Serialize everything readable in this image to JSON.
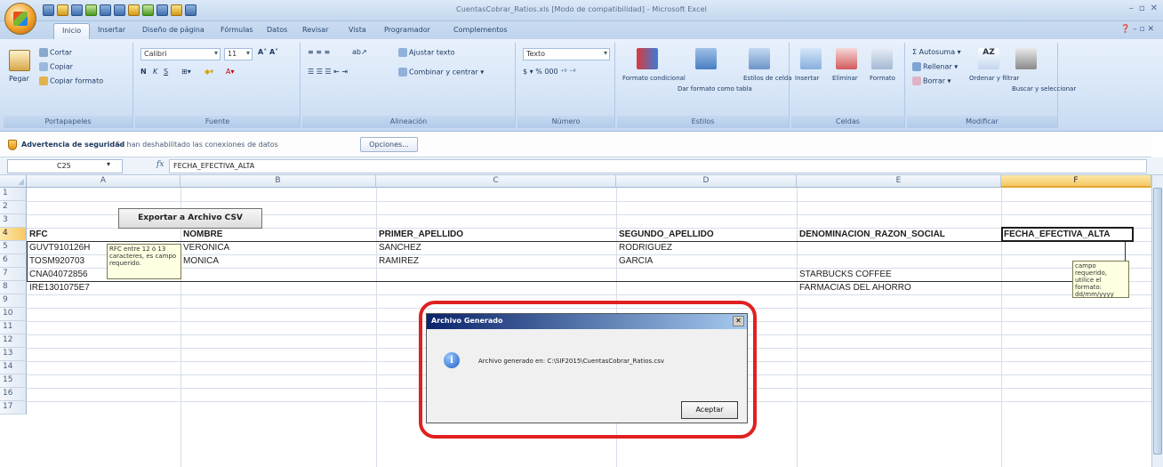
{
  "window": {
    "title": "CuentasCobrar_Ratios.xls [Modo de compatibilidad] - Microsoft Excel",
    "controls": [
      "–",
      "▫",
      "✕"
    ]
  },
  "tabs": [
    "Inicio",
    "Insertar",
    "Diseño de página",
    "Fórmulas",
    "Datos",
    "Revisar",
    "Vista",
    "Programador",
    "Complementos"
  ],
  "ribbon": {
    "clipboard": {
      "paste": "Pegar",
      "cut": "Cortar",
      "copy": "Copiar",
      "format_painter": "Copiar formato",
      "label": "Portapapeles"
    },
    "font": {
      "name": "Calibri",
      "size": "11",
      "label": "Fuente"
    },
    "alignment": {
      "wrap": "Ajustar texto",
      "merge": "Combinar y centrar",
      "label": "Alineación"
    },
    "number": {
      "format": "Texto",
      "label": "Número"
    },
    "styles": {
      "conditional": "Formato condicional",
      "table": "Dar formato como tabla",
      "cell_styles": "Estilos de celda",
      "label": "Estilos"
    },
    "cells": {
      "insert": "Insertar",
      "delete": "Eliminar",
      "format": "Formato",
      "label": "Celdas"
    },
    "editing": {
      "autosum": "Autosuma",
      "fill": "Rellenar",
      "clear": "Borrar",
      "sort": "Ordenar y filtrar",
      "find": "Buscar y seleccionar",
      "label": "Modificar"
    }
  },
  "security": {
    "title": "Advertencia de seguridad",
    "message": "Se han deshabilitado las conexiones de datos",
    "options_label": "Opciones..."
  },
  "formula_bar": {
    "name_box": "C25",
    "fx": "fx",
    "content": "FECHA_EFECTIVA_ALTA"
  },
  "columns": [
    "A",
    "B",
    "C",
    "D",
    "E",
    "F"
  ],
  "rows": [
    "1",
    "2",
    "3",
    "4",
    "5",
    "6",
    "7",
    "8",
    "9",
    "10",
    "11",
    "12",
    "13",
    "14",
    "15",
    "16",
    "17"
  ],
  "export_button": "Exportar a Archivo CSV",
  "table": {
    "headers": [
      "RFC",
      "NOMBRE",
      "PRIMER_APELLIDO",
      "SEGUNDO_APELLIDO",
      "DENOMINACION_RAZON_SOCIAL",
      "FECHA_EFECTIVA_ALTA"
    ],
    "rows": [
      [
        "GUVT910126H",
        "VERONICA",
        "SANCHEZ",
        "RODRIGUEZ",
        "",
        ""
      ],
      [
        "TOSM920703",
        "MONICA",
        "RAMIREZ",
        "GARCIA",
        "",
        ""
      ],
      [
        "CNA04072856",
        "",
        "",
        "",
        "STARBUCKS COFFEE",
        ""
      ],
      [
        "IRE1301075E7",
        "",
        "",
        "",
        "FARMACIAS DEL AHORRO",
        ""
      ]
    ]
  },
  "comments": {
    "rfc": "RFC entre 12 ó 13 caracteres, es campo requerido.",
    "fecha": "campo requerido, utilice el formato: dd/mm/yyyy"
  },
  "dialog": {
    "title": "Archivo Generado",
    "message": "Archivo generado en: C:\\SIF2015\\CuentasCobrar_Ratios.csv",
    "ok_label": "Aceptar",
    "close": "✕"
  }
}
